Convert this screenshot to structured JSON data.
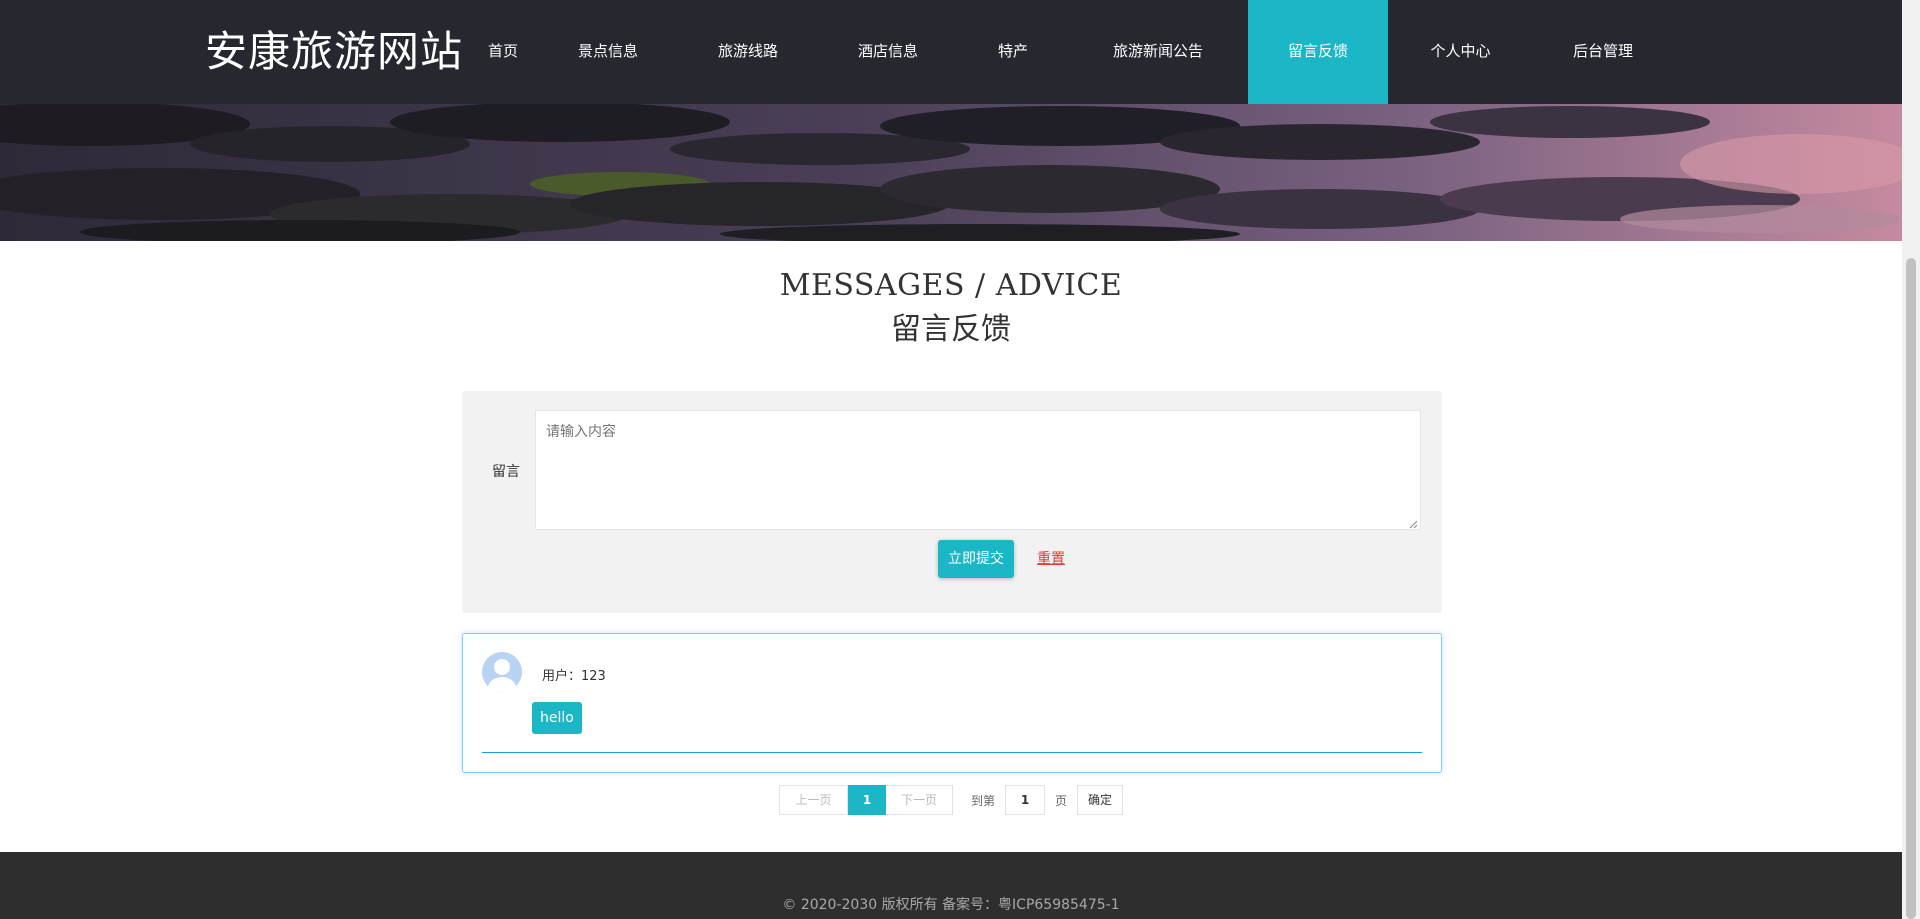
{
  "header": {
    "logo": "安康旅游网站",
    "nav": [
      {
        "label": "首页",
        "active": false
      },
      {
        "label": "景点信息",
        "active": false
      },
      {
        "label": "旅游线路",
        "active": false
      },
      {
        "label": "酒店信息",
        "active": false
      },
      {
        "label": "特产",
        "active": false
      },
      {
        "label": "旅游新闻公告",
        "active": false
      },
      {
        "label": "留言反馈",
        "active": true
      },
      {
        "label": "个人中心",
        "active": false
      },
      {
        "label": "后台管理",
        "active": false
      }
    ]
  },
  "page": {
    "title_en": "MESSAGES / ADVICE",
    "title_cn": "留言反馈"
  },
  "form": {
    "label": "留言",
    "placeholder": "请输入内容",
    "value": "",
    "submit_label": "立即提交",
    "reset_label": "重置"
  },
  "messages": [
    {
      "user": "用户：123",
      "content": "hello",
      "avatar_icon": "user-avatar-icon"
    }
  ],
  "pagination": {
    "prev_label": "上一页",
    "current": "1",
    "next_label": "下一页",
    "goto_label": "到第",
    "goto_value": "1",
    "page_unit": "页",
    "confirm_label": "确定"
  },
  "footer": {
    "copyright": "© 2020-2030 版权所有 备案号：粤ICP65985475-1"
  },
  "colors": {
    "header_bg": "#262830",
    "accent": "#1bb7c7",
    "reset": "#e53935",
    "footer_bg": "#2e2e2f"
  }
}
